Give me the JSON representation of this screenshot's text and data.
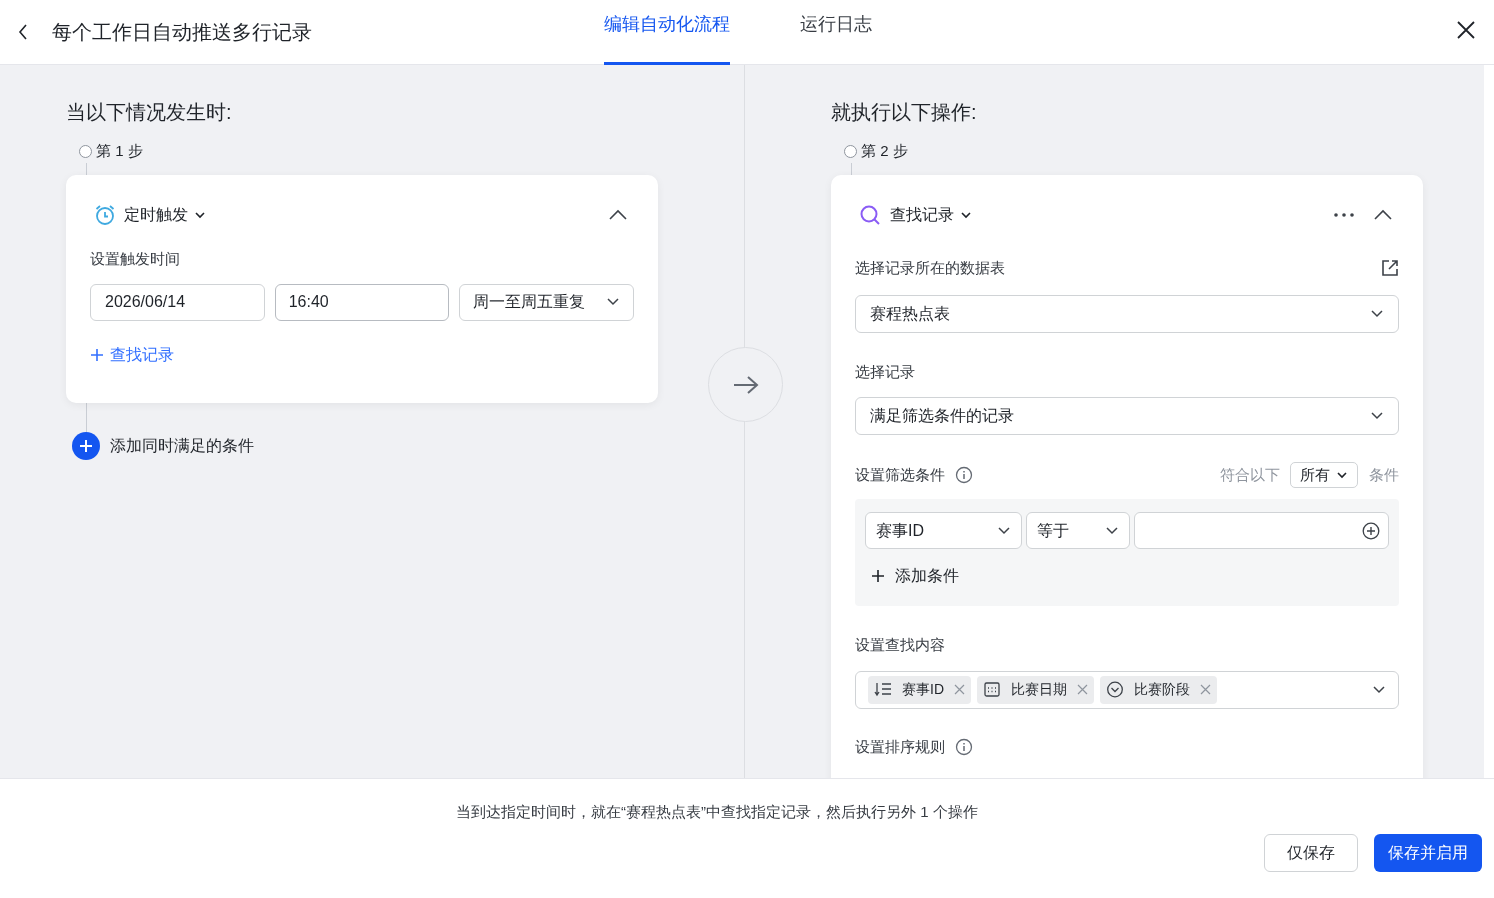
{
  "header": {
    "title": "每个工作日自动推送多行记录",
    "tabs": [
      {
        "label": "编辑自动化流程",
        "selected": true
      },
      {
        "label": "运行日志",
        "selected": false
      }
    ]
  },
  "trigger_section": {
    "heading": "当以下情况发生时:",
    "step_label": "第 1 步",
    "card": {
      "type_label": "定时触发",
      "field_label": "设置触发时间",
      "date": "2026/06/14",
      "time": "16:40",
      "repeat": "周一至周五重复",
      "add_link": "查找记录"
    },
    "add_condition": "添加同时满足的条件"
  },
  "action_section": {
    "heading": "就执行以下操作:",
    "step_label": "第 2 步",
    "card": {
      "type_label": "查找记录",
      "table_label": "选择记录所在的数据表",
      "table_value": "赛程热点表",
      "record_label": "选择记录",
      "record_value": "满足筛选条件的记录",
      "filter_label": "设置筛选条件",
      "match_prefix": "符合以下",
      "match_value": "所有",
      "match_suffix": "条件",
      "conditions": [
        {
          "field": "赛事ID",
          "operator": "等于"
        }
      ],
      "add_condition": "添加条件",
      "content_label": "设置查找内容",
      "content_tags": [
        {
          "label": "赛事ID",
          "kind": "number"
        },
        {
          "label": "比赛日期",
          "kind": "date"
        },
        {
          "label": "比赛阶段",
          "kind": "option"
        }
      ],
      "sort_label": "设置排序规则"
    }
  },
  "footer": {
    "summary": "当到达指定时间时，就在“赛程热点表”中查找指定记录，然后执行另外 1 个操作",
    "buttons": [
      {
        "label": "仅保存",
        "kind": "secondary"
      },
      {
        "label": "保存并启用",
        "kind": "primary"
      }
    ]
  }
}
